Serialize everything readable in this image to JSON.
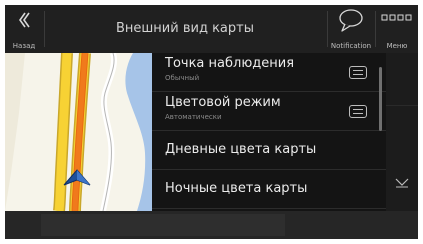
{
  "topbar": {
    "back_label": "Назад",
    "back_icon": "double-chevron-left-icon",
    "title": "Внешний вид карты",
    "notification_label": "Notification",
    "notification_icon": "speech-bubble-icon",
    "menu_label": "Меню",
    "menu_icon": "grid-icon"
  },
  "settings_list": {
    "items": [
      {
        "title": "Точка наблюдения",
        "subtitle": "Обычный",
        "icon": "list-picker-icon"
      },
      {
        "title": "Цветовой режим",
        "subtitle": "Автоматически",
        "icon": "list-picker-icon"
      },
      {
        "title": "Дневные цвета карты"
      },
      {
        "title": "Ночные цвета карты"
      }
    ]
  },
  "right_panel": {
    "scroll_down_icon": "chevron-down-icon"
  },
  "colors": {
    "background": "#181818",
    "topbar": "#202020",
    "text": "#ececec",
    "subtext": "#8a8a8a",
    "route_orange": "#f07a1c",
    "road_yellow": "#f7d234",
    "water": "#a6c4e8",
    "position_arrow": "#1d4f9a"
  }
}
